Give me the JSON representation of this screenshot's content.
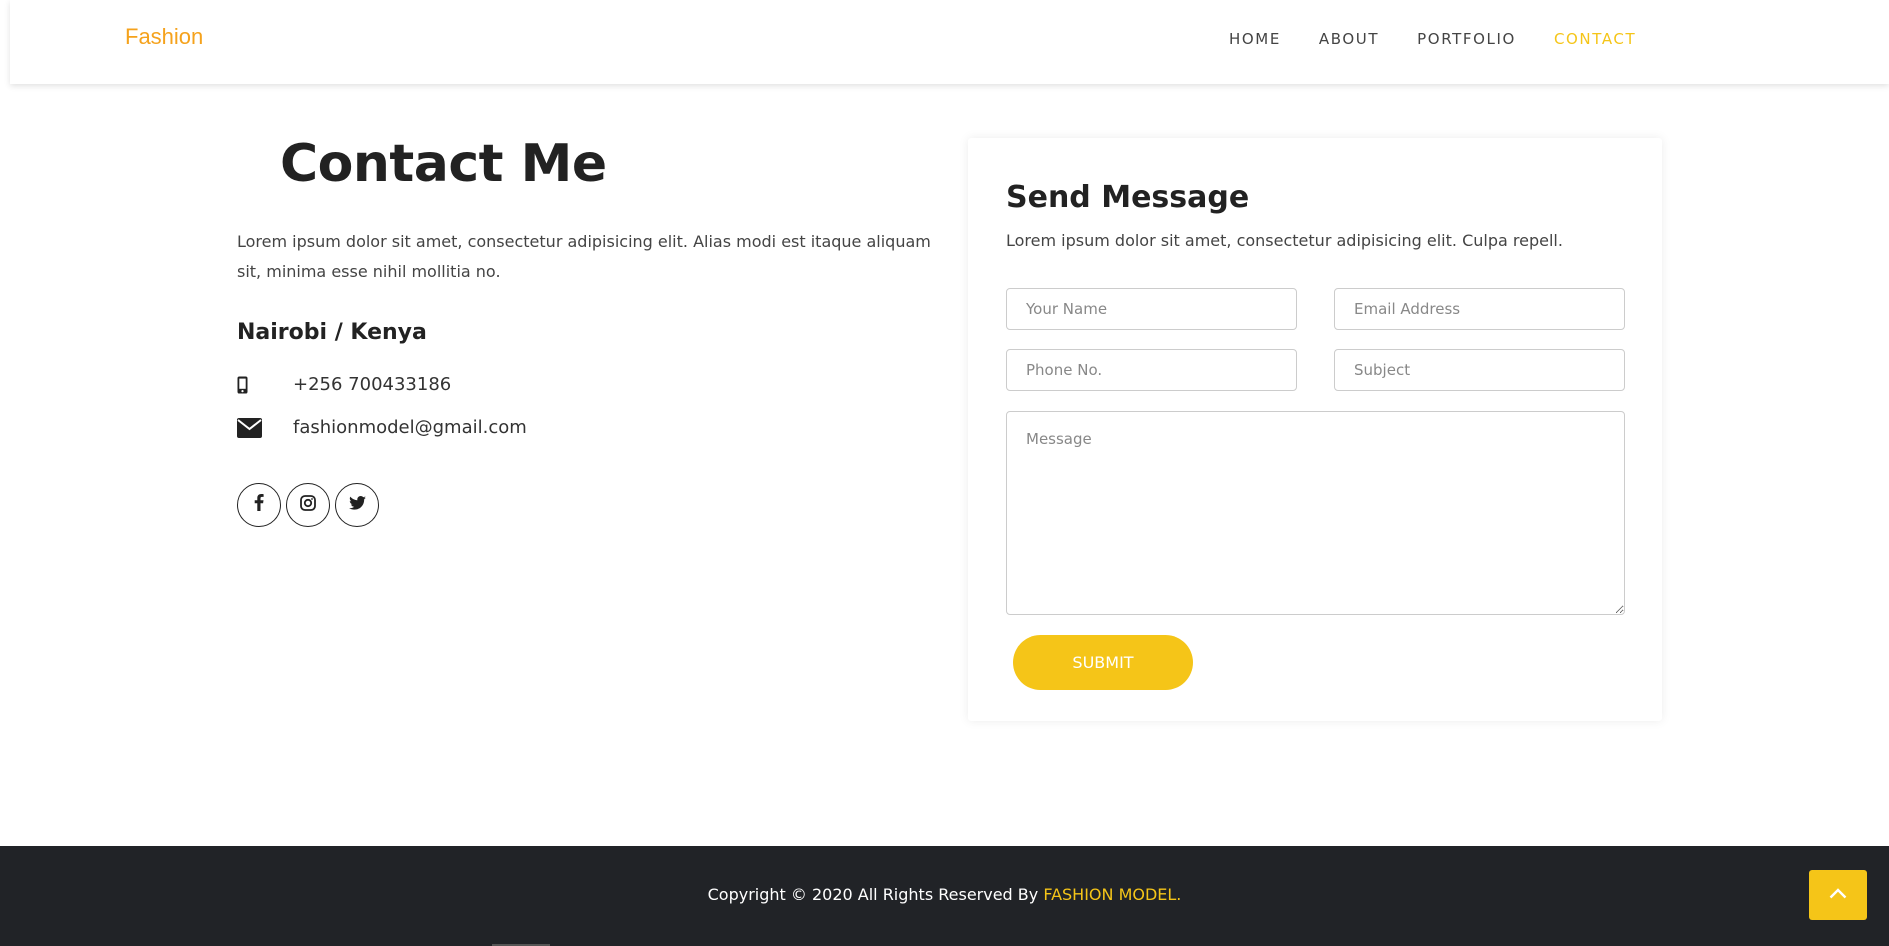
{
  "header": {
    "brand": "Fashion",
    "nav": [
      {
        "label": "HOME",
        "active": false
      },
      {
        "label": "ABOUT",
        "active": false
      },
      {
        "label": "PORTFOLIO",
        "active": false
      },
      {
        "label": "CONTACT",
        "active": true
      }
    ]
  },
  "contact": {
    "title": "Contact Me",
    "lead": "Lorem ipsum dolor sit amet, consectetur adipisicing elit. Alias modi est itaque aliquam sit, minima esse nihil mollitia no.",
    "city": "Nairobi / Kenya",
    "phone": "+256 700433186",
    "email": "fashionmodel@gmail.com",
    "socials": [
      "facebook-icon",
      "instagram-icon",
      "twitter-icon"
    ]
  },
  "form": {
    "title": "Send Message",
    "subtitle": "Lorem ipsum dolor sit amet, consectetur adipisicing elit. Culpa repell.",
    "name_placeholder": "Your Name",
    "email_placeholder": "Email Address",
    "phone_placeholder": "Phone No.",
    "subject_placeholder": "Subject",
    "message_placeholder": "Message",
    "submit_label": "SUBMIT"
  },
  "footer": {
    "copyright_prefix": "Copyright © 2020 All Rights Reserved By ",
    "copyright_brand": "FASHION MODEL."
  },
  "colors": {
    "accent": "#f5c518",
    "brand": "#f5a21c",
    "footer_bg": "#212327"
  }
}
